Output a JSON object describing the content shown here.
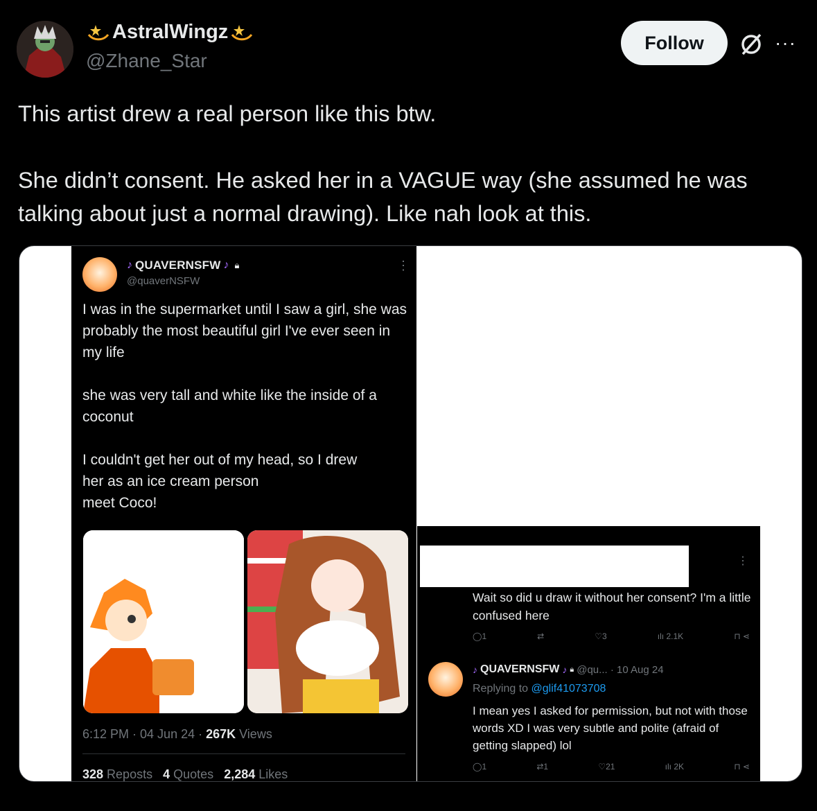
{
  "post": {
    "display_name": "AstralWingz",
    "handle": "@Zhane_Star",
    "follow_label": "Follow",
    "more_label": "···",
    "text_line1": "This artist drew a real person like this btw.",
    "text_line2": "She didn’t consent. He asked her in a VAGUE way (she assumed he was talking about just a normal drawing). Like nah look at this."
  },
  "screenshot_left": {
    "name": "QUAVERNSFW",
    "handle": "@quaverNSFW",
    "para1": "I was in the supermarket until I saw a girl, she was probably the most beautiful girl I've ever seen in my life",
    "para2": "she was very tall and white like the inside of a coconut",
    "para3_line1": "I couldn't get her out of my head, so I drew",
    "para3_line2": "her as an ice cream person",
    "para3_line3": "meet Coco!",
    "time_date": "6:12 PM · 04 Jun 24 · ",
    "views_count": "267K",
    "views_label": " Views",
    "reposts_count": "328",
    "reposts_label": " Reposts",
    "quotes_count": "4",
    "quotes_label": " Quotes",
    "likes_count": "2,284",
    "likes_label": " Likes"
  },
  "screenshot_right": {
    "reply1_text": "Wait so did u draw it without her consent? I'm a little confused here",
    "reply1_actions": {
      "replies": "1",
      "reposts": "",
      "likes": "3",
      "views": "2.1K"
    },
    "reply2_name": "QUAVERNSFW",
    "reply2_handle_time": "@qu... · 10 Aug 24",
    "replying_to_label": "Replying to ",
    "replying_to_handle": "@glif41073708",
    "reply2_text": "I mean yes I asked for permission, but not with those words XD I was very subtle and polite (afraid of getting slapped) lol",
    "reply2_actions": {
      "replies": "1",
      "reposts": "1",
      "likes": "21",
      "views": "2K"
    }
  },
  "colors": {
    "background": "#000000",
    "text": "#e7e9ea",
    "muted": "#71767b",
    "link": "#1d9bf0",
    "follow_bg": "#eff3f4"
  }
}
